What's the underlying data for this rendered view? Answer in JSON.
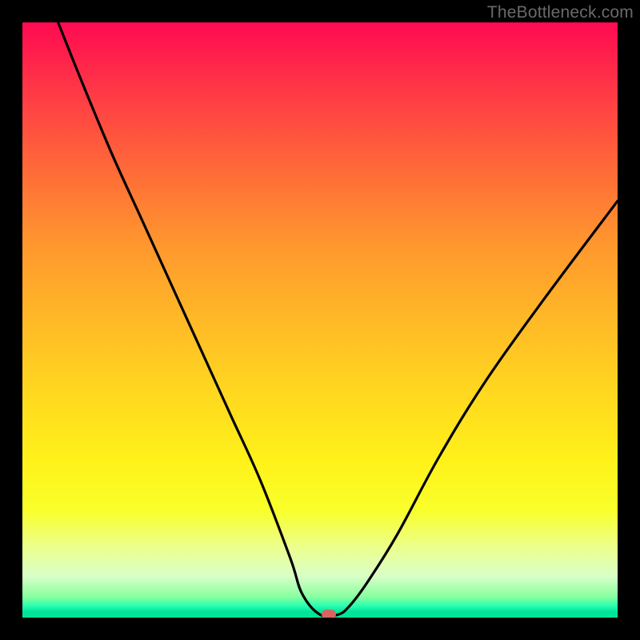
{
  "watermark": "TheBottleneck.com",
  "chart_data": {
    "type": "line",
    "title": "",
    "xlabel": "",
    "ylabel": "",
    "xlim": [
      0,
      100
    ],
    "ylim": [
      0,
      100
    ],
    "grid": false,
    "legend": false,
    "background_gradient": {
      "top": "#ff0a52",
      "mid": "#ffd71f",
      "bottom": "#00e59a"
    },
    "series": [
      {
        "name": "bottleneck-curve",
        "color": "#000000",
        "x": [
          6,
          10,
          15,
          20,
          25,
          30,
          35,
          40,
          45,
          47,
          50,
          53,
          55,
          58,
          63,
          70,
          78,
          88,
          100
        ],
        "y": [
          100,
          90,
          78,
          67,
          56,
          45,
          34,
          23,
          10,
          4,
          0.5,
          0.5,
          2,
          6,
          14,
          27,
          40,
          54,
          70
        ]
      }
    ],
    "marker": {
      "x": 51.5,
      "y": 0.5,
      "color": "#d9635e"
    }
  }
}
